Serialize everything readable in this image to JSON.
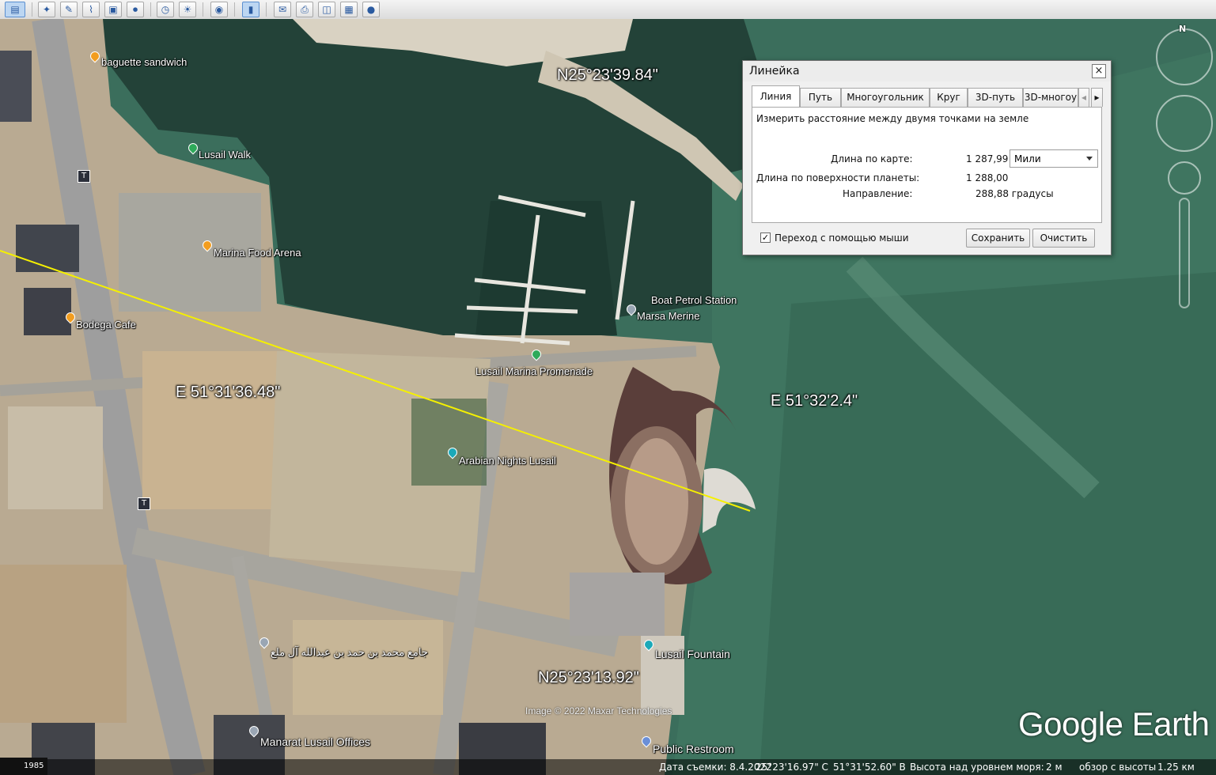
{
  "map": {
    "coords": {
      "n_top": "N25°23'39.84\"",
      "n_bottom": "N25°23'13.92\"",
      "e_left": "E 51°31'36.48\"",
      "e_right": "E 51°32'2.4\""
    },
    "places": {
      "baguette": "baguette sandwich",
      "lusail_walk": "Lusail Walk",
      "marina_food": "Marina Food Arena",
      "bodega": "Bodega Cafe",
      "boat_petrol": "Boat Petrol Station",
      "marsa": "Marsa Merine",
      "promenade": "Lusail Marina Promenade",
      "arabian": "Arabian Nights Lusail",
      "mosque": "جامع محمد بن حمد بن عبدالله آل ملع",
      "fountain": "Lusail Fountain",
      "manarat": "Manarat Lusail Offices",
      "restroom": "Public Restroom"
    },
    "image_credit": "Image © 2022 Maxar Technologies",
    "brand": "Google Earth",
    "compass_letter": "N",
    "ruler_line_color": "#f5f000"
  },
  "ruler": {
    "title": "Линейка",
    "close": "×",
    "tabs": [
      "Линия",
      "Путь",
      "Многоугольник",
      "Круг",
      "3D-путь",
      "3D-многоу"
    ],
    "active_tab": "Линия",
    "scroll_left": "◂",
    "scroll_right": "▸",
    "description": "Измерить расстояние между двумя точками на земле",
    "map_length_label": "Длина по карте:",
    "map_length_value": "1 287,99",
    "units": "Мили",
    "ground_length_label": "Длина по поверхности планеты:",
    "ground_length_value": "1 288,00",
    "heading_label": "Направление:",
    "heading_value": "288,88 градусы",
    "mouse_nav_label": "Переход с помощью мыши",
    "mouse_nav_checked": "✓",
    "save": "Сохранить",
    "clear": "Очистить"
  },
  "status": {
    "historical_year": "1985",
    "date": "Дата съемки: 8.4.2022",
    "lat": "25°23'16.97\" С",
    "lon": "51°31'52.60\" В",
    "elev_label": "Высота над уровнем моря:",
    "elev_value": "2 м",
    "eye_label": "обзор с высоты",
    "eye_value": "1.25 км"
  },
  "toolbar": {
    "icons": [
      "sidebar-icon",
      "placemark-icon",
      "polygon-icon",
      "path-icon",
      "image-overlay-icon",
      "record-tour-icon",
      "historical-imagery-icon",
      "sun-icon",
      "planets-icon",
      "ruler-icon",
      "email-icon",
      "print-icon",
      "save-image-icon",
      "view-in-maps-icon",
      "earth-gallery-icon"
    ],
    "glyphs": [
      "▤",
      "✦",
      "✎",
      "⌇",
      "▣",
      "⏺",
      "◷",
      "☀",
      "◉",
      "▮",
      "✉",
      "⎙",
      "◫",
      "▦",
      "●"
    ]
  }
}
